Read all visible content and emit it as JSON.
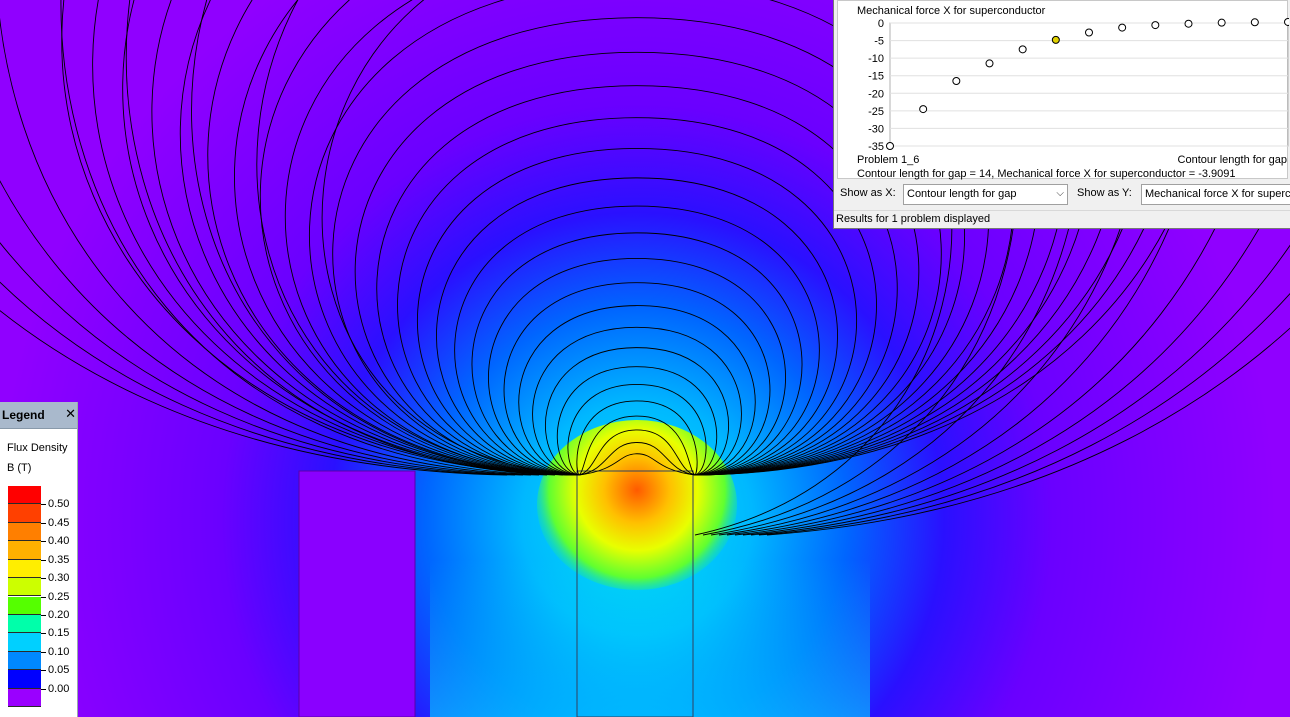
{
  "legend": {
    "title": "Legend",
    "close": "✕",
    "quantity": "Flux Density",
    "unit": "B (T)",
    "levels": [
      "0.50",
      "0.45",
      "0.40",
      "0.35",
      "0.30",
      "0.25",
      "0.20",
      "0.15",
      "0.10",
      "0.05",
      "0.00"
    ],
    "colors": [
      "#ff0000",
      "#ff4000",
      "#ff7f00",
      "#ffb000",
      "#ffee00",
      "#ccff00",
      "#55ff00",
      "#00ffaa",
      "#00d0ff",
      "#0088ff",
      "#0000ff",
      "#9a00ff"
    ]
  },
  "chart": {
    "footer_left": "Problem 1_6",
    "footer_right": "Contour length for gap",
    "readout": "Contour length for gap = 14, Mechanical force X for superconductor = -3.9091",
    "show_x_label": "Show as X:",
    "show_x_value": "Contour length for gap",
    "show_y_label": "Show as Y:",
    "show_y_value": "Mechanical force X for superc",
    "status": "Results for 1 problem displayed"
  },
  "chart_data": {
    "type": "scatter",
    "title": "Mechanical force X for superconductor",
    "xlabel": "Contour length for gap",
    "ylabel": "",
    "y_ticks": [
      0,
      -5,
      -10,
      -15,
      -20,
      -25,
      -30,
      -35
    ],
    "ylim": [
      -35,
      0
    ],
    "x": [
      0,
      1,
      2,
      3,
      4,
      5,
      6,
      7,
      8,
      9,
      10,
      11,
      12
    ],
    "y": [
      -35,
      -24.5,
      -16.5,
      -11.5,
      -7.5,
      -4.8,
      -2.7,
      -1.3,
      -0.6,
      -0.2,
      0.1,
      0.2,
      0.3
    ],
    "highlight_index": 5,
    "grid": true
  }
}
